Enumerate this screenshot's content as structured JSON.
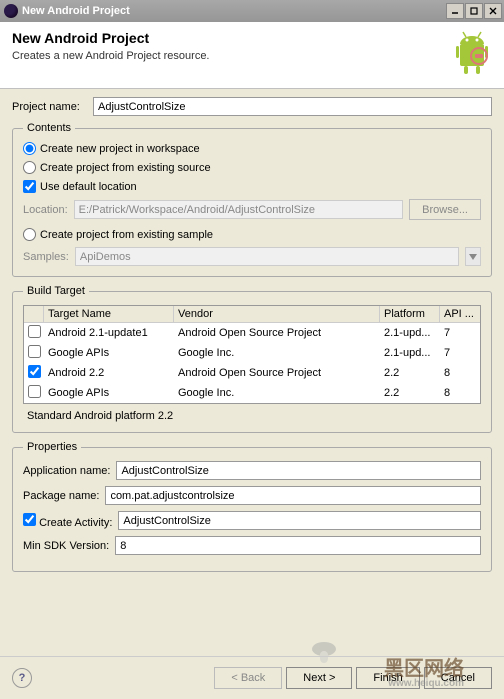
{
  "titlebar": {
    "title": "New Android Project"
  },
  "banner": {
    "title": "New Android Project",
    "subtitle": "Creates a new Android Project resource."
  },
  "project_name": {
    "label": "Project name:",
    "value": "AdjustControlSize"
  },
  "contents": {
    "legend": "Contents",
    "opt_workspace": "Create new project in workspace",
    "opt_existing": "Create project from existing source",
    "use_default": "Use default location",
    "location_label": "Location:",
    "location_value": "E:/Patrick/Workspace/Android/AdjustControlSize",
    "browse": "Browse...",
    "opt_sample": "Create project from existing sample",
    "samples_label": "Samples:",
    "samples_value": "ApiDemos"
  },
  "build_target": {
    "legend": "Build Target",
    "cols": {
      "name": "Target Name",
      "vendor": "Vendor",
      "platform": "Platform",
      "api": "API ..."
    },
    "rows": [
      {
        "checked": false,
        "name": "Android 2.1-update1",
        "vendor": "Android Open Source Project",
        "platform": "2.1-upd...",
        "api": "7"
      },
      {
        "checked": false,
        "name": "Google APIs",
        "vendor": "Google Inc.",
        "platform": "2.1-upd...",
        "api": "7"
      },
      {
        "checked": true,
        "name": "Android 2.2",
        "vendor": "Android Open Source Project",
        "platform": "2.2",
        "api": "8"
      },
      {
        "checked": false,
        "name": "Google APIs",
        "vendor": "Google Inc.",
        "platform": "2.2",
        "api": "8"
      }
    ],
    "note": "Standard Android platform 2.2"
  },
  "properties": {
    "legend": "Properties",
    "app_name_label": "Application name:",
    "app_name_value": "AdjustControlSize",
    "pkg_label": "Package name:",
    "pkg_value": "com.pat.adjustcontrolsize",
    "create_activity_label": "Create Activity:",
    "create_activity_value": "AdjustControlSize",
    "min_sdk_label": "Min SDK Version:",
    "min_sdk_value": "8"
  },
  "buttons": {
    "back": "< Back",
    "next": "Next >",
    "finish": "Finish",
    "cancel": "Cancel"
  },
  "watermark": {
    "main": "黑区网络",
    "sub": "www.heiqu.com"
  }
}
